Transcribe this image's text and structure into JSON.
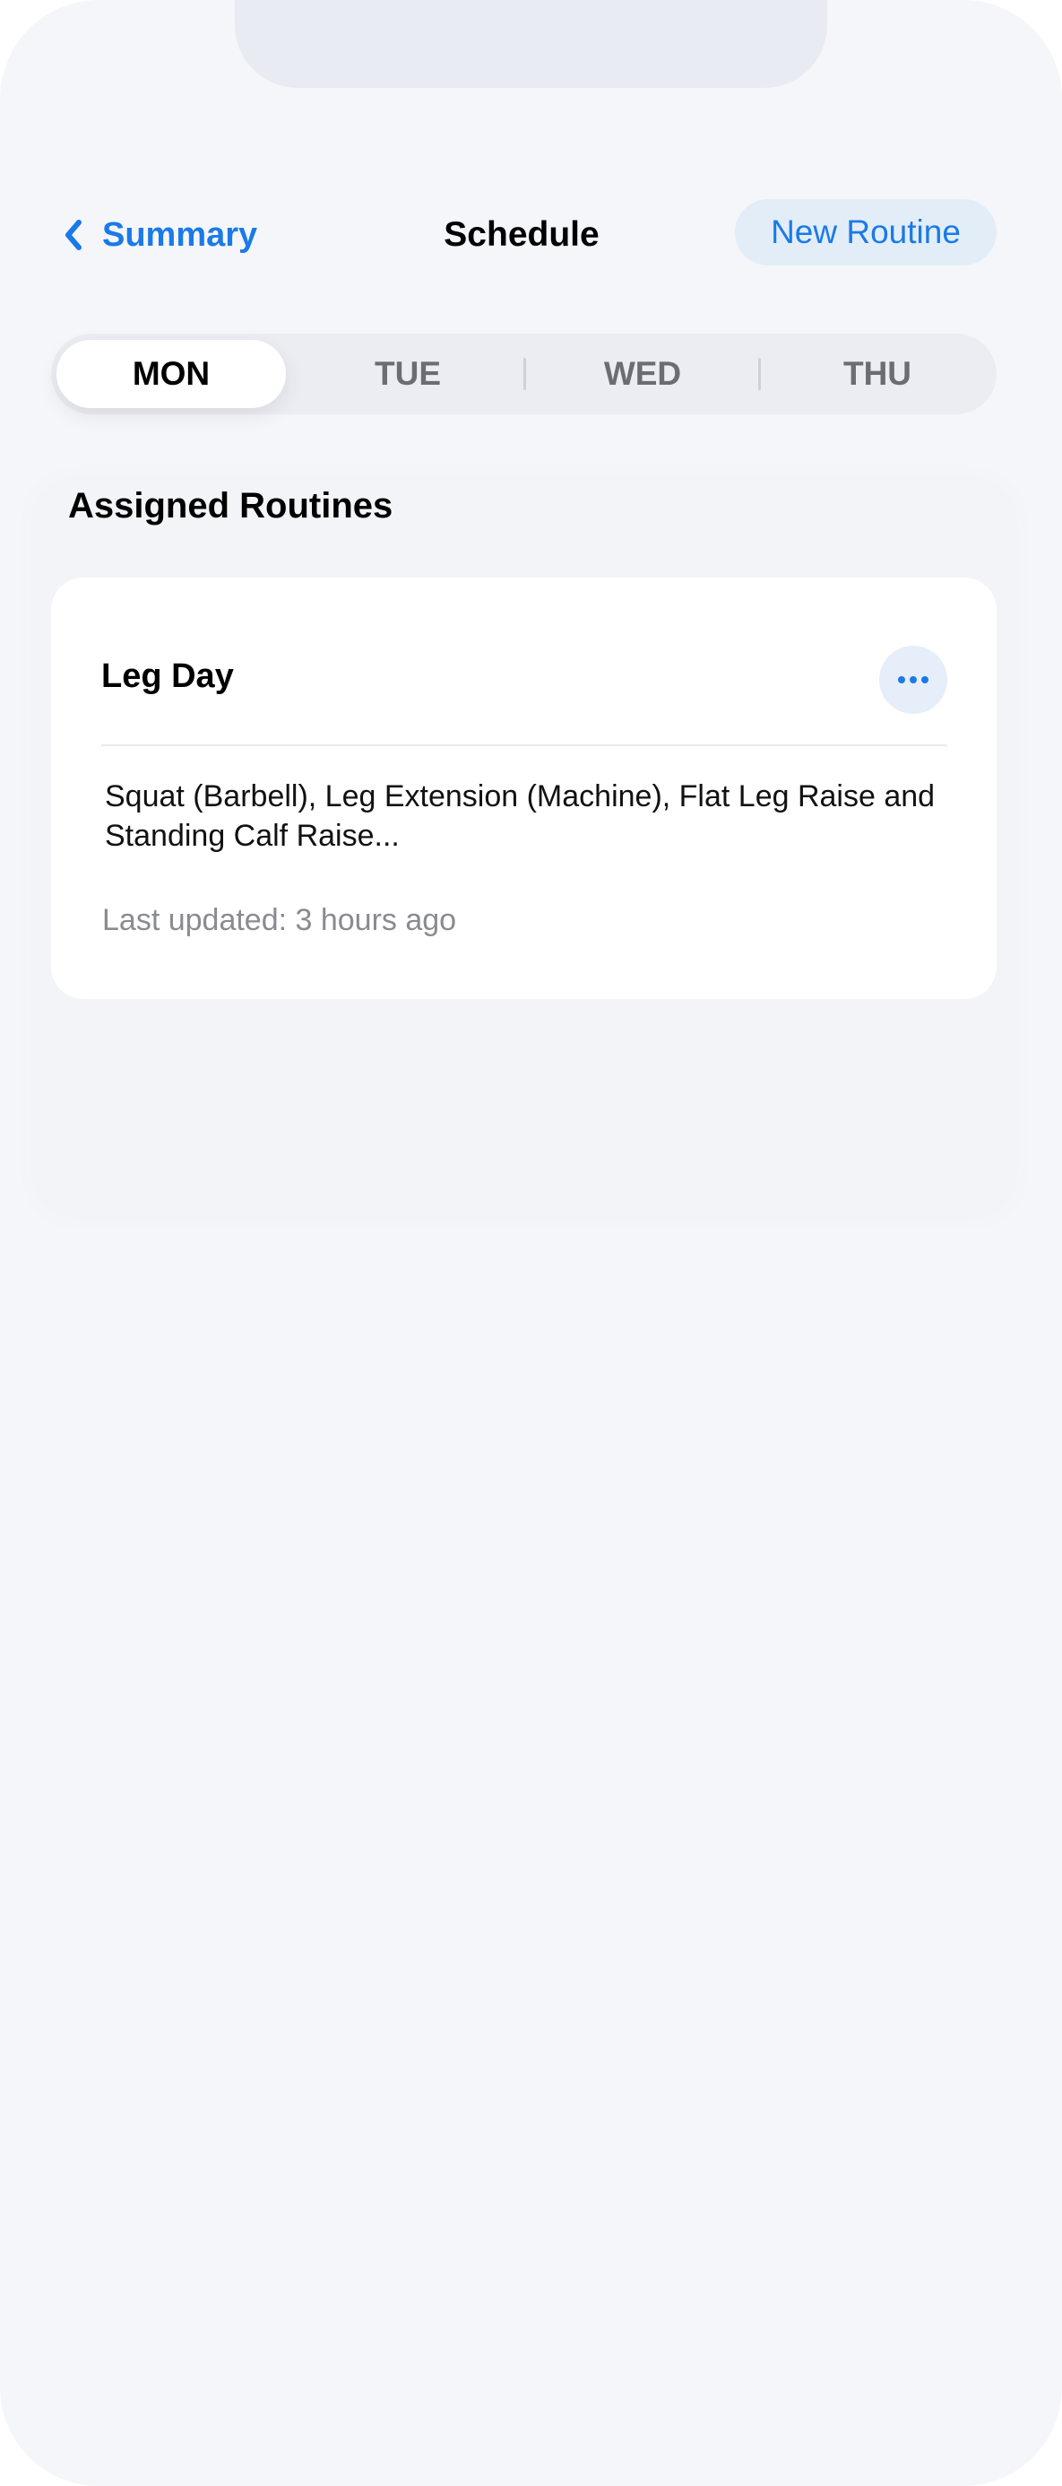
{
  "nav": {
    "back_label": "Summary",
    "title": "Schedule",
    "action_label": "New Routine"
  },
  "days": [
    {
      "label": "MON",
      "selected": true
    },
    {
      "label": "TUE",
      "selected": false
    },
    {
      "label": "WED",
      "selected": false
    },
    {
      "label": "THU",
      "selected": false
    }
  ],
  "section": {
    "title": "Assigned Routines"
  },
  "routines": [
    {
      "name": "Leg Day",
      "description": "Squat (Barbell), Leg Extension (Machine), Flat Leg Raise and Standing Calf Raise...",
      "updated": "Last updated: 3 hours ago",
      "more_icon": "ellipsis-icon"
    }
  ],
  "colors": {
    "accent": "#1a7ae8",
    "accent_soft": "#e3edf8",
    "background": "#f5f6fa"
  },
  "icons": {
    "back": "chevron-left-icon"
  }
}
